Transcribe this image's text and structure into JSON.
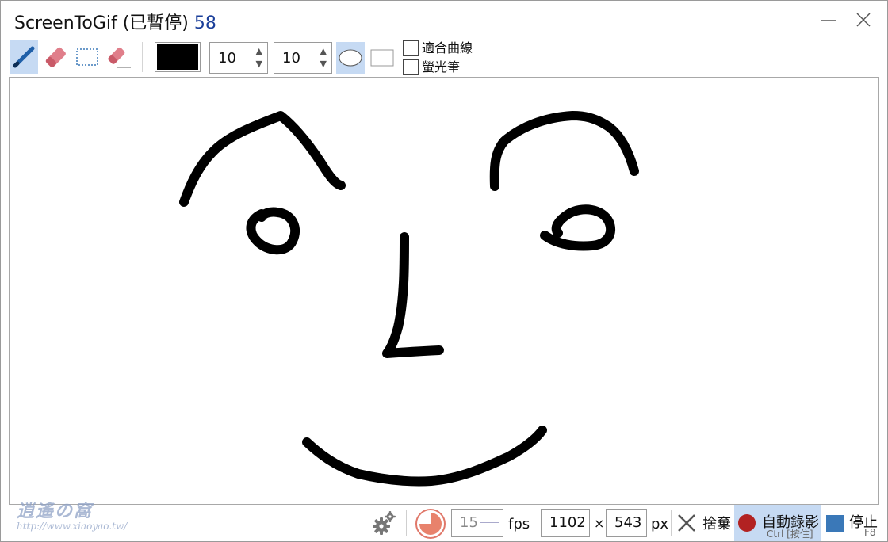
{
  "window": {
    "title": "ScreenToGif (已暫停)",
    "frame_count": "58"
  },
  "toolbar": {
    "tools": [
      "pen",
      "eraser",
      "selection",
      "stroke-eraser"
    ],
    "active_tool": "pen",
    "color": "#000000",
    "width_value": "10",
    "height_value": "10",
    "tip_shape": "ellipse",
    "fit_curves_label": "適合曲線",
    "highlighter_label": "螢光筆"
  },
  "bottom_bar": {
    "fps_value": "15",
    "fps_label": "fps",
    "width": "1102",
    "times": "×",
    "height": "543",
    "px_label": "px",
    "discard_label": "捨棄",
    "record_label": "自動錄影",
    "record_shortcut": "Ctrl [按住]",
    "stop_label": "停止",
    "stop_shortcut": "F8"
  },
  "colors": {
    "accent": "#c6daf3",
    "title_count": "#1b3f9a",
    "record": "#b22222",
    "stop": "#3a78b8"
  },
  "watermark": {
    "line1": "逍遙の窩",
    "line2": "http://www.xiaoyao.tw/"
  }
}
